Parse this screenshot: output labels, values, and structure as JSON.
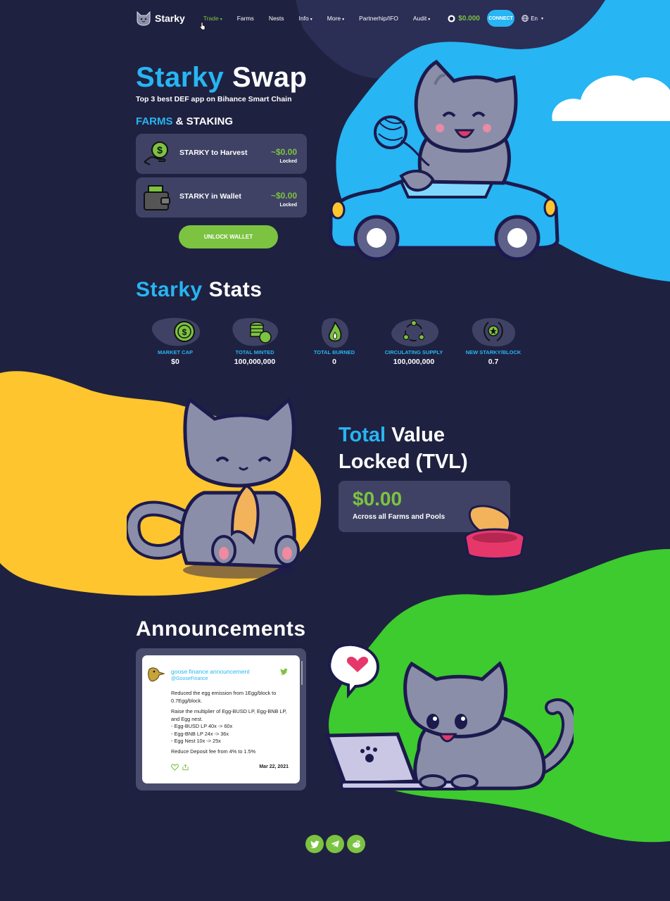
{
  "nav": {
    "brand": "Starky",
    "items": [
      {
        "label": "Trade",
        "caret": true
      },
      {
        "label": "Farms",
        "caret": false
      },
      {
        "label": "Nests",
        "caret": false
      },
      {
        "label": "Info",
        "caret": true
      },
      {
        "label": "More",
        "caret": true
      },
      {
        "label": "Partnerhip/IFO",
        "caret": false
      },
      {
        "label": "Audit",
        "caret": true
      }
    ],
    "balance": "$0.000",
    "connect_label": "CONNECT",
    "language": "En"
  },
  "hero": {
    "title_part1": "Starky",
    "title_part2": "Swap",
    "subtitle": "Top 3 best DEF app on Bihance  Smart Chain",
    "section_part1": "FARMS",
    "section_part2": "& STAKING",
    "cards": [
      {
        "label": "STARKY to Harvest",
        "value": "~$0.00",
        "status": "Locked",
        "icon": "hand-coin-icon"
      },
      {
        "label": "STARKY in Wallet",
        "value": "~$0.00",
        "status": "Locked",
        "icon": "wallet-icon"
      }
    ],
    "unlock_label": "UNLOCK WALLET"
  },
  "stats": {
    "title_part1": "Starky",
    "title_part2": "Stats",
    "items": [
      {
        "label": "MARKET CAP",
        "value": "$0",
        "icon": "dollar-coin-icon"
      },
      {
        "label": "TOTAL MINTED",
        "value": "100,000,000",
        "icon": "coin-stack-icon"
      },
      {
        "label": "TOTAL BURNED",
        "value": "0",
        "icon": "flame-icon"
      },
      {
        "label": "CIRCULATING SUPPLY",
        "value": "100,000,000",
        "icon": "circulation-icon"
      },
      {
        "label": "NEW STARKY/BLOCK",
        "value": "0.7",
        "icon": "laurel-star-icon"
      }
    ]
  },
  "tvl": {
    "title_part1": "Total",
    "title_part2": "Value",
    "title_line2": "Locked (TVL)",
    "value": "$0.00",
    "caption": "Across all Farms and Pools"
  },
  "announcements": {
    "title": "Announcements",
    "tweet": {
      "author": "goose finance announcement",
      "handle": "@GooseFinance",
      "p1": "Reduced the egg emission from 1Egg/block to 0.7Egg/block.",
      "p2_lines": [
        "Raise the multiplier of Egg-BUSD LP, Egg-BNB LP, and Egg nest.",
        "- Egg-BUSD LP 40x -> 60x",
        "- Egg-BNB LP 24x -> 36x",
        "- Egg Nest 10x -> 25x"
      ],
      "p3": "Reduce Deposit fee from 4% to 1.5%",
      "date": "Mar 22, 2021"
    }
  },
  "social": [
    "twitter-icon",
    "telegram-icon",
    "reddit-icon"
  ],
  "colors": {
    "background": "#1f2140",
    "accent_blue": "#27b5f3",
    "accent_green": "#7cc341",
    "card": "#3f4264",
    "blob_yellow": "#fec52e",
    "blob_green": "#3dcb2f",
    "blob_sky": "#27b5f3"
  }
}
